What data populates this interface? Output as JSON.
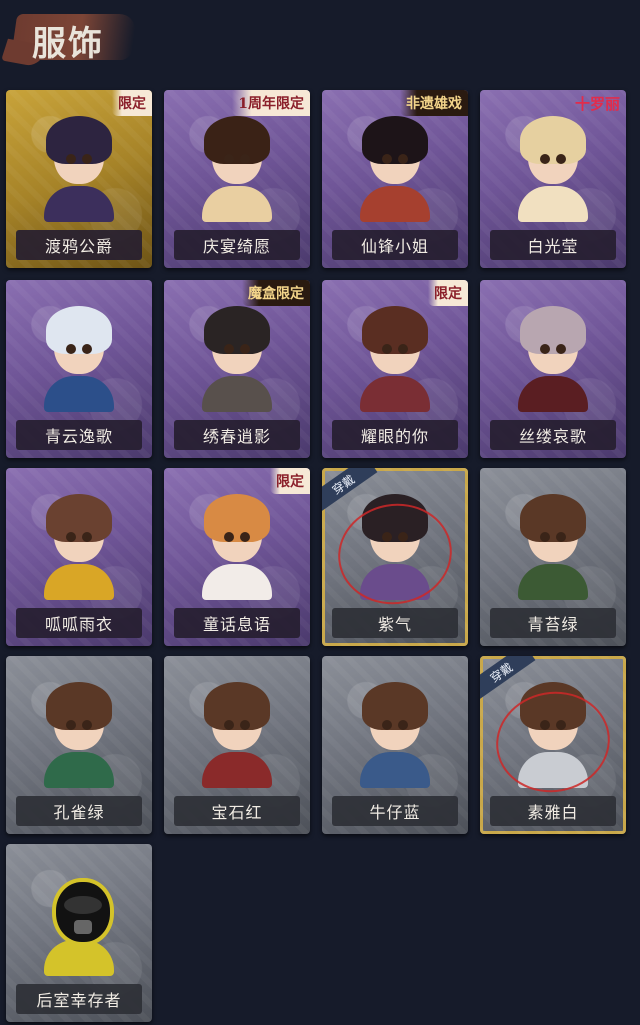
{
  "header": {
    "title": "服饰"
  },
  "costumes": [
    {
      "name": "渡鸦公爵",
      "tier": "gold",
      "badge": "限定",
      "badge_type": "limited",
      "hair": "#2d2440",
      "outfit": "#3c2f5c"
    },
    {
      "name": "庆宴绮愿",
      "tier": "purple",
      "badge": "1周年限定",
      "badge_type": "limited",
      "hair": "#3a2216",
      "outfit": "#e9cfa1"
    },
    {
      "name": "仙锋小姐",
      "tier": "purple",
      "badge": "非遗雄戏",
      "badge_type": "special",
      "hair": "#1d1418",
      "outfit": "#a6402f"
    },
    {
      "name": "白光莹",
      "tier": "purple",
      "badge": "十罗丽",
      "badge_type": "brand",
      "hair": "#e6d0a0",
      "outfit": "#f1e0c0"
    },
    {
      "name": "青云逸歌",
      "tier": "purple",
      "badge": "",
      "badge_type": "",
      "hair": "#dfe6f0",
      "outfit": "#2c4f8a"
    },
    {
      "name": "绣春逍影",
      "tier": "purple",
      "badge": "魔盒限定",
      "badge_type": "special",
      "hair": "#2a2424",
      "outfit": "#58504c"
    },
    {
      "name": "耀眼的你",
      "tier": "purple",
      "badge": "限定",
      "badge_type": "limited",
      "hair": "#5a2e22",
      "outfit": "#7a2e34"
    },
    {
      "name": "丝缕哀歌",
      "tier": "purple",
      "badge": "",
      "badge_type": "",
      "hair": "#b8a6b0",
      "outfit": "#5a1e22"
    },
    {
      "name": "呱呱雨衣",
      "tier": "purple",
      "badge": "",
      "badge_type": "",
      "hair": "#6a4130",
      "outfit": "#d9a626"
    },
    {
      "name": "童话息语",
      "tier": "purple",
      "badge": "限定",
      "badge_type": "limited",
      "hair": "#d88a44",
      "outfit": "#f2ece8"
    },
    {
      "name": "紫气",
      "tier": "grey",
      "badge": "",
      "badge_type": "",
      "worn": true,
      "worn_label": "穿戴",
      "hair": "#2a2024",
      "outfit": "#6a4c8c"
    },
    {
      "name": "青苔绿",
      "tier": "grey",
      "badge": "",
      "badge_type": "",
      "hair": "#5a3826",
      "outfit": "#3c5a34"
    },
    {
      "name": "孔雀绿",
      "tier": "grey",
      "badge": "",
      "badge_type": "",
      "hair": "#5a3826",
      "outfit": "#2f6a4a"
    },
    {
      "name": "宝石红",
      "tier": "grey",
      "badge": "",
      "badge_type": "",
      "hair": "#5a3826",
      "outfit": "#8a2a2a"
    },
    {
      "name": "牛仔蓝",
      "tier": "grey",
      "badge": "",
      "badge_type": "",
      "hair": "#5a3826",
      "outfit": "#3a5a8a"
    },
    {
      "name": "素雅白",
      "tier": "grey",
      "badge": "",
      "badge_type": "",
      "worn": true,
      "worn_label": "穿戴",
      "hair": "#5a3826",
      "outfit": "#c9ccd2"
    },
    {
      "name": "后室幸存者",
      "tier": "grey",
      "badge": "",
      "badge_type": "",
      "hazmat": true,
      "hair": "#d4c32a",
      "outfit": "#d4c32a"
    }
  ]
}
